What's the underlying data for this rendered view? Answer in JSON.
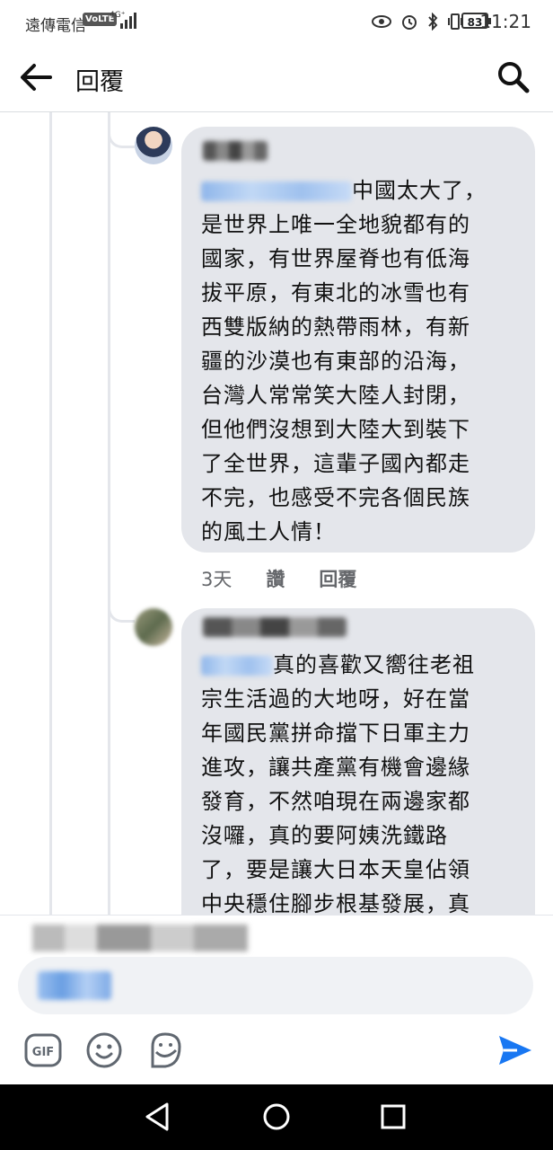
{
  "status_bar": {
    "carrier": "遠傳電信",
    "volte": "VoLTE",
    "network": "4G⁺",
    "battery": "83",
    "time": "11:21"
  },
  "header": {
    "title": "回覆"
  },
  "comments": [
    {
      "text": "中國太大了，\n是世界上唯一全地貌都有的\n國家，有世界屋脊也有低海\n拔平原，有東北的冰雪也有\n西雙版納的熱帶雨林，有新\n疆的沙漠也有東部的沿海，\n台灣人常常笑大陸人封閉，\n但他們沒想到大陸大到裝下\n了全世界，這輩子國內都走\n不完，也感受不完各個民族\n的風土人情！",
      "time": "3天",
      "like": "讚",
      "reply": "回覆"
    },
    {
      "text": "真的喜歡又嚮往老祖\n宗生活過的大地呀，好在當\n年國民黨拼命擋下日軍主力\n進攻，讓共產黨有機會邊緣\n發育，不然咱現在兩邊家都\n沒囉，真的要阿姨洗鐵路\n了，要是讓大日本天皇佔領\n中央穩住腳步根基發展，真"
    }
  ],
  "composer": {
    "reply_note_partial": "正在",
    "toolbar": {
      "gif_label": "GIF"
    }
  },
  "icons": {
    "back": "back-arrow-icon",
    "search": "search-icon",
    "send": "send-icon",
    "emoji": "emoji-icon",
    "sticker": "sticker-icon"
  },
  "colors": {
    "bubble": "#e4e6eb",
    "send": "#1877f2",
    "navbar": "#000000"
  }
}
